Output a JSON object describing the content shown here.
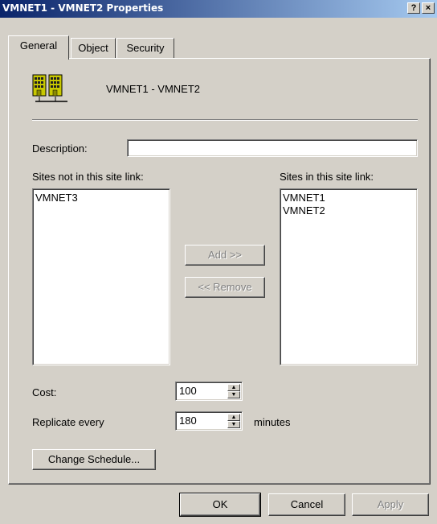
{
  "window": {
    "title": "VMNET1 - VMNET2 Properties",
    "help_glyph": "?",
    "close_glyph": "×"
  },
  "tabs": [
    {
      "label": "General",
      "active": true
    },
    {
      "label": "Object",
      "active": false
    },
    {
      "label": "Security",
      "active": false
    }
  ],
  "general": {
    "object_name": "VMNET1 - VMNET2",
    "description": {
      "label": "Description:",
      "value": ""
    },
    "sites_not_in_link": {
      "label": "Sites not in this site link:",
      "items": [
        "VMNET3"
      ]
    },
    "sites_in_link": {
      "label": "Sites in this site link:",
      "items": [
        "VMNET1",
        "VMNET2"
      ]
    },
    "add_button": "Add >>",
    "remove_button": "<< Remove",
    "cost": {
      "label": "Cost:",
      "value": "100"
    },
    "replicate": {
      "label": "Replicate every",
      "value": "180",
      "unit": "minutes"
    },
    "change_schedule_button": "Change Schedule..."
  },
  "footer": {
    "ok": "OK",
    "cancel": "Cancel",
    "apply": "Apply"
  },
  "colors": {
    "title_start": "#0a246a",
    "title_end": "#a6caf0",
    "face": "#d4d0c8"
  }
}
